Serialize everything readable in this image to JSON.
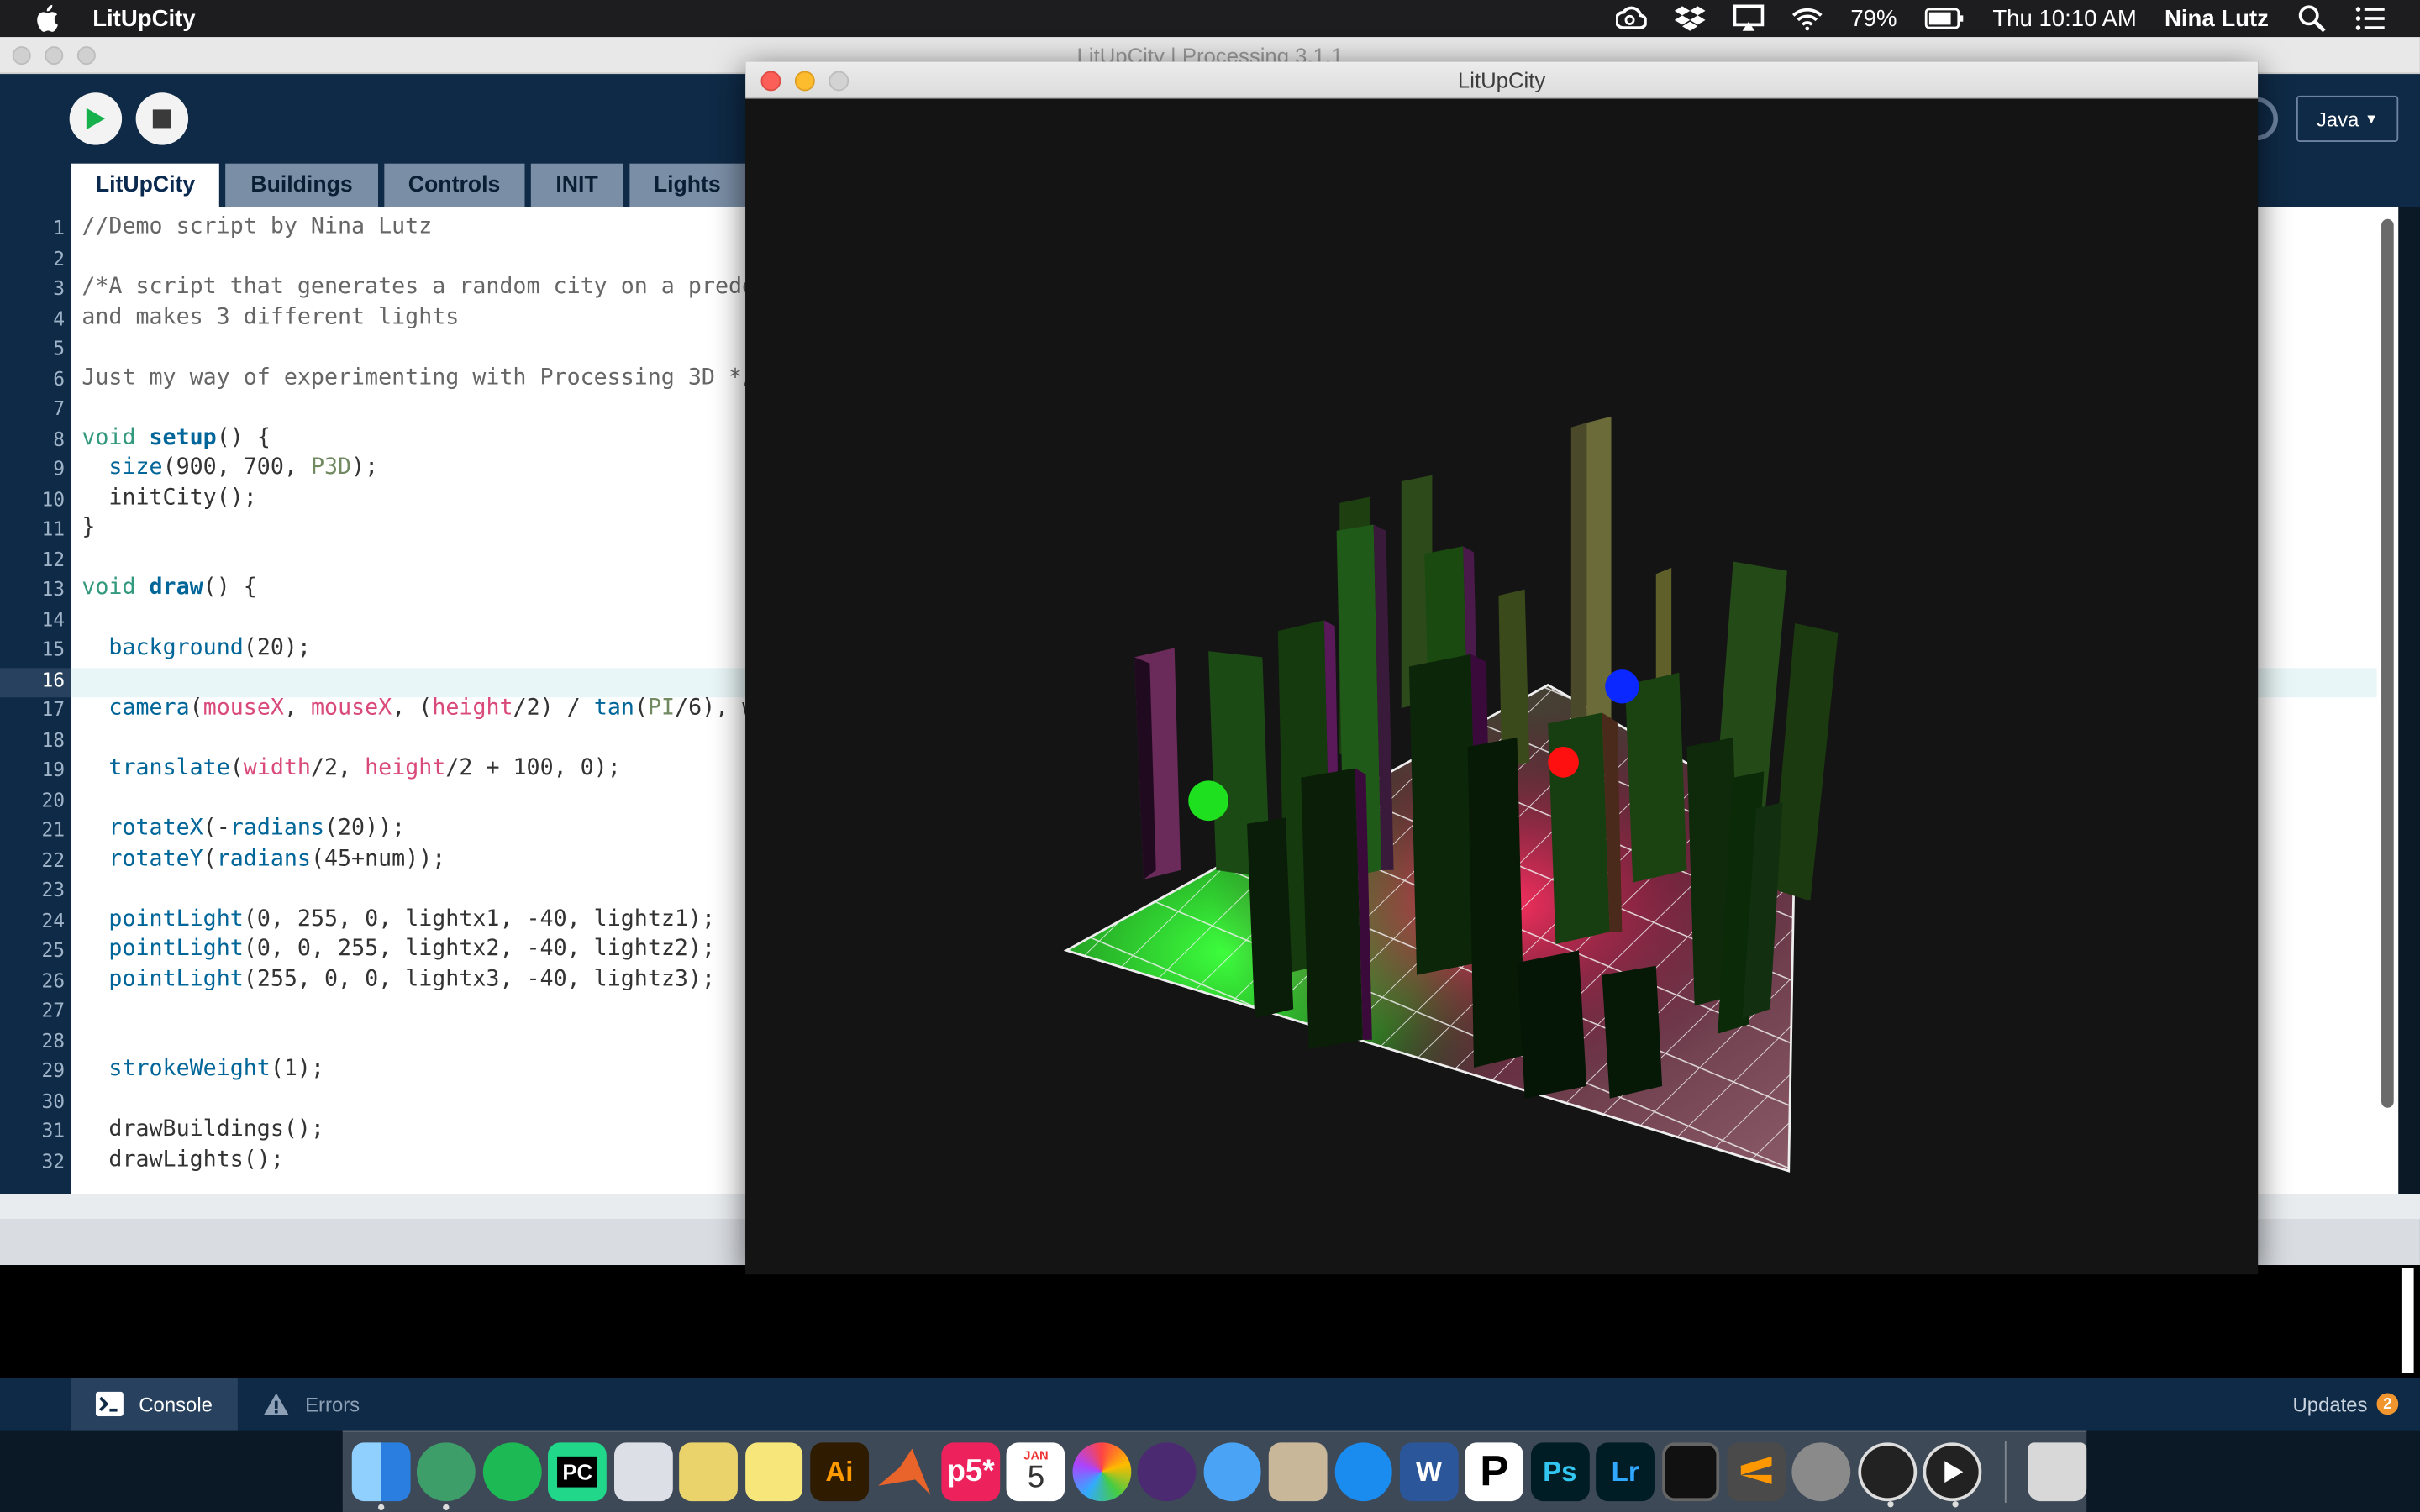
{
  "menubar": {
    "app_name": "LitUpCity",
    "battery": "79%",
    "clock": "Thu 10:10 AM",
    "user": "Nina Lutz",
    "icons": [
      "creative-cloud-icon",
      "dropbox-icon",
      "airplay-icon",
      "wifi-icon",
      "battery-icon",
      "spotlight-icon",
      "notification-center-icon"
    ]
  },
  "ide": {
    "window_title": "LitUpCity | Processing 3.1.1",
    "mode": "Java",
    "tabs": [
      "LitUpCity",
      "Buildings",
      "Controls",
      "INIT",
      "Lights"
    ],
    "footer": {
      "console_label": "Console",
      "errors_label": "Errors",
      "updates_label": "Updates",
      "updates_count": "2"
    }
  },
  "code": {
    "lines": [
      "//Demo script by Nina Lutz",
      "",
      "/*A script that generates a random city on a prede",
      "and makes 3 different lights",
      "",
      "Just my way of experimenting with Processing 3D */",
      "",
      "void setup() {",
      "  size(900, 700, P3D);",
      "  initCity();",
      "}",
      "",
      "void draw() {",
      "",
      "  background(20);",
      "",
      "  camera(mouseX, mouseX, (height/2) / tan(PI/6), w",
      "",
      "  translate(width/2, height/2 + 100, 0);",
      "",
      "  rotateX(-radians(20));",
      "  rotateY(radians(45+num));",
      "",
      "  pointLight(0, 255, 0, lightx1, -40, lightz1);",
      "  pointLight(0, 0, 255, lightx2, -40, lightz2);",
      "  pointLight(255, 0, 0, lightx3, -40, lightz3);",
      "",
      "",
      "  strokeWeight(1);",
      "",
      "  drawBuildings();",
      "  drawLights();"
    ],
    "current_line": 16
  },
  "sketch": {
    "title": "LitUpCity",
    "background": "#141414",
    "light_colors": [
      "#00ff00",
      "#0000ff",
      "#ff0000"
    ]
  },
  "dock": {
    "apps": [
      "finder-icon",
      "atom-icon",
      "spotify-icon",
      "pycharm-icon",
      "preview-icon",
      "python-launcher-icon",
      "notes-icon",
      "illustrator-icon",
      "matlab-icon",
      "p5-icon",
      "calendar-icon",
      "photos-icon",
      "github-icon",
      "messages-icon",
      "mail-icon",
      "safari-icon",
      "word-icon",
      "processing-p-icon",
      "photoshop-icon",
      "lightroom-icon",
      "activity-monitor-icon",
      "sublime-icon",
      "system-preferences-icon",
      "processing-icon",
      "quicktime-icon",
      "trash-icon"
    ],
    "calendar_month": "JAN",
    "calendar_day": "5",
    "illustrator_label": "Ai",
    "p5_label": "p5*",
    "photoshop_label": "Ps",
    "lightroom_label": "Lr",
    "word_label": "W",
    "pycharm_label": "PC"
  }
}
